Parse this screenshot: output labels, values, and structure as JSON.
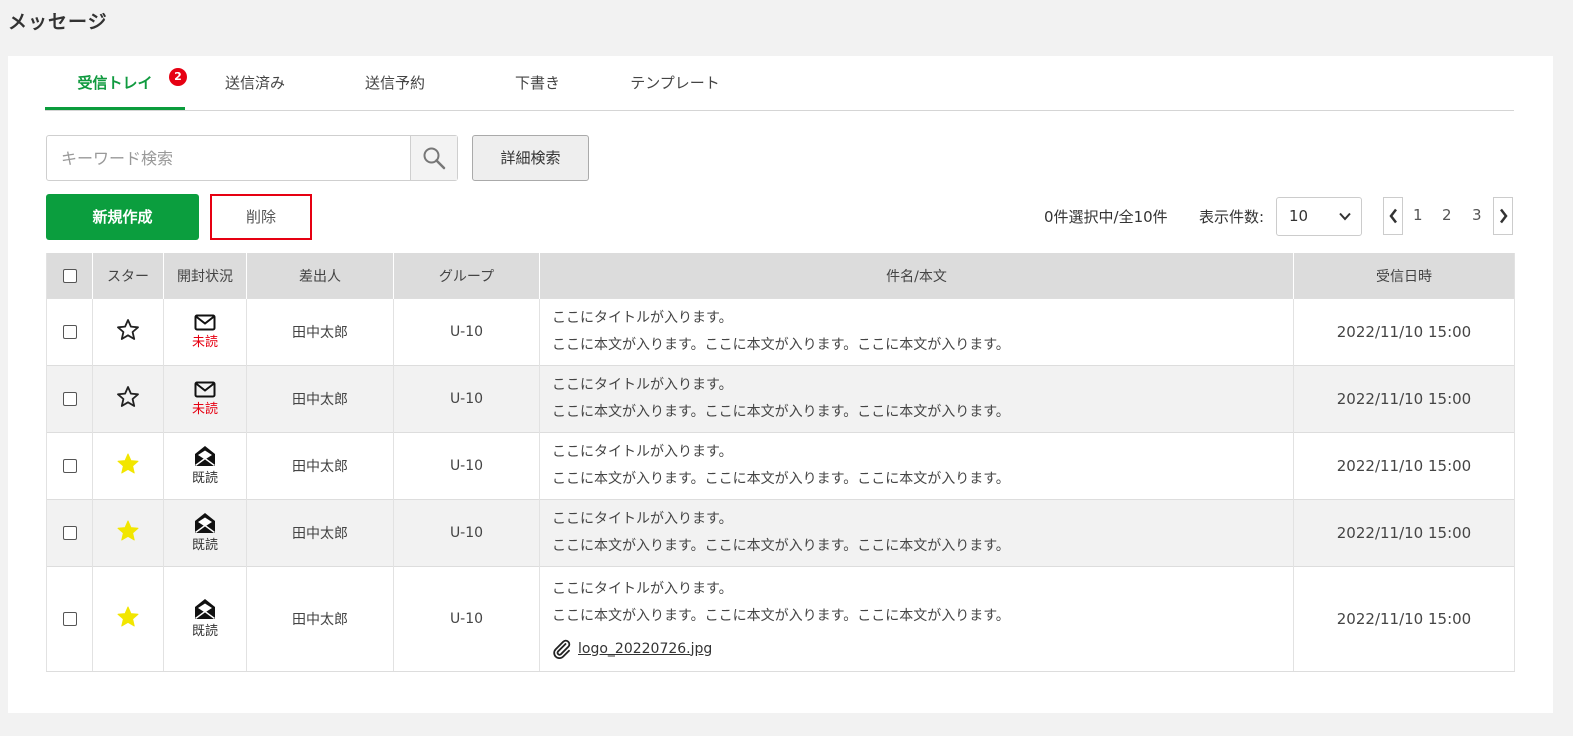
{
  "page_title": "メッセージ",
  "tabs": [
    {
      "label": "受信トレイ",
      "badge": "2",
      "active": true
    },
    {
      "label": "送信済み"
    },
    {
      "label": "送信予約"
    },
    {
      "label": "下書き"
    },
    {
      "label": "テンプレート"
    }
  ],
  "search": {
    "placeholder": "キーワード検索",
    "advanced_label": "詳細検索"
  },
  "actions": {
    "new_label": "新規作成",
    "delete_label": "削除"
  },
  "selection_text": "0件選択中/全10件",
  "per_page": {
    "label": "表示件数:",
    "value": "10"
  },
  "pagination": {
    "pages": [
      "1",
      "2",
      "3"
    ]
  },
  "table": {
    "headers": [
      "スター",
      "開封状況",
      "差出人",
      "グループ",
      "件名/本文",
      "受信日時"
    ],
    "rows": [
      {
        "starred": false,
        "status": "未読",
        "sender": "田中太郎",
        "group": "U-10",
        "title": "ここにタイトルが入ります。",
        "body": "ここに本文が入ります。ここに本文が入ります。ここに本文が入ります。",
        "date": "2022/11/10 15:00"
      },
      {
        "starred": false,
        "status": "未読",
        "sender": "田中太郎",
        "group": "U-10",
        "title": "ここにタイトルが入ります。",
        "body": "ここに本文が入ります。ここに本文が入ります。ここに本文が入ります。",
        "date": "2022/11/10 15:00"
      },
      {
        "starred": true,
        "status": "既読",
        "sender": "田中太郎",
        "group": "U-10",
        "title": "ここにタイトルが入ります。",
        "body": "ここに本文が入ります。ここに本文が入ります。ここに本文が入ります。",
        "date": "2022/11/10 15:00"
      },
      {
        "starred": true,
        "status": "既読",
        "sender": "田中太郎",
        "group": "U-10",
        "title": "ここにタイトルが入ります。",
        "body": "ここに本文が入ります。ここに本文が入ります。ここに本文が入ります。",
        "date": "2022/11/10 15:00"
      },
      {
        "starred": true,
        "status": "既読",
        "sender": "田中太郎",
        "group": "U-10",
        "title": "ここにタイトルが入ります。",
        "body": "ここに本文が入ります。ここに本文が入ります。ここに本文が入ります。",
        "attachment": "logo_20220726.jpg",
        "date": "2022/11/10 15:00"
      }
    ]
  },
  "colors": {
    "accent": "#0b9e3e",
    "badge": "#e60012",
    "unread": "#e60012",
    "star": "#f2e600"
  },
  "icons": {
    "search": "search-icon",
    "star": "star-icon",
    "unread": "envelope-closed-icon",
    "read": "envelope-open-icon",
    "attachment": "paperclip-icon"
  }
}
